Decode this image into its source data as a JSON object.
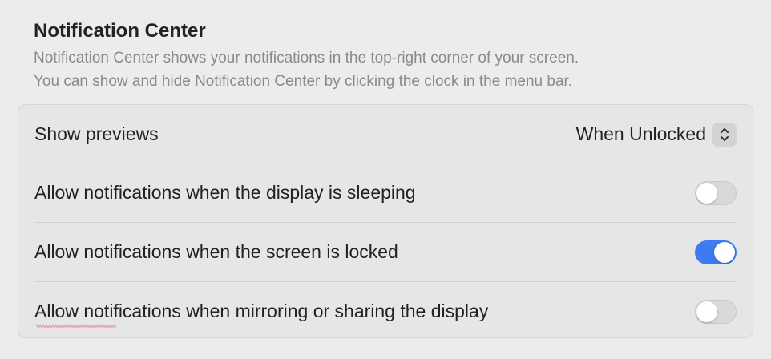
{
  "section": {
    "title": "Notification Center",
    "description_line1": "Notification Center shows your notifications in the top-right corner of your screen.",
    "description_line2": "You can show and hide Notification Center by clicking the clock in the menu bar."
  },
  "settings": {
    "show_previews": {
      "label": "Show previews",
      "value": "When Unlocked",
      "icon": "chevron-up-down-icon"
    },
    "display_sleeping": {
      "label": "Allow notifications when the display is sleeping",
      "enabled": false
    },
    "screen_locked": {
      "label": "Allow notifications when the screen is locked",
      "enabled": true
    },
    "mirroring": {
      "label": "Allow notifications when mirroring or sharing the display",
      "enabled": false
    }
  },
  "colors": {
    "accent": "#3e7bee",
    "spellcheck_underline": "#e8a0bf"
  }
}
